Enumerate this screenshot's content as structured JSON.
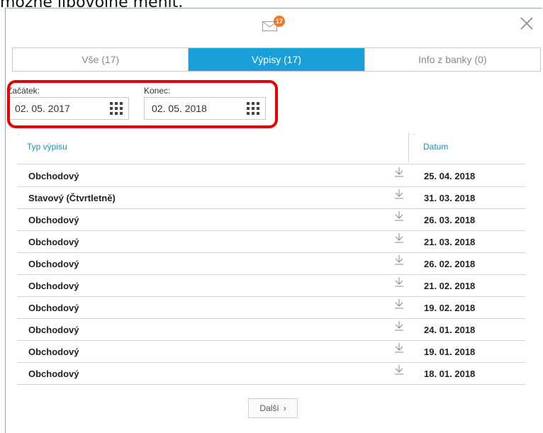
{
  "top_text": "možné libovolně měnit.",
  "header": {
    "unread_count": "17"
  },
  "tabs": [
    {
      "label": "Vše (17)"
    },
    {
      "label": "Výpisy (17)"
    },
    {
      "label": "Info z banky (0)"
    }
  ],
  "filters": {
    "start_label": "Začátek:",
    "start_value": "02. 05. 2017",
    "end_label": "Konec:",
    "end_value": "02. 05. 2018"
  },
  "table": {
    "col_type": "Typ výpisu",
    "col_date": "Datum",
    "rows": [
      {
        "type": "Obchodový",
        "date": "25. 04. 2018"
      },
      {
        "type": "Stavový (Čtvrtletně)",
        "date": "31. 03. 2018"
      },
      {
        "type": "Obchodový",
        "date": "26. 03. 2018"
      },
      {
        "type": "Obchodový",
        "date": "21. 03. 2018"
      },
      {
        "type": "Obchodový",
        "date": "26. 02. 2018"
      },
      {
        "type": "Obchodový",
        "date": "21. 02. 2018"
      },
      {
        "type": "Obchodový",
        "date": "19. 02. 2018"
      },
      {
        "type": "Obchodový",
        "date": "24. 01. 2018"
      },
      {
        "type": "Obchodový",
        "date": "19. 01. 2018"
      },
      {
        "type": "Obchodový",
        "date": "18. 01. 2018"
      }
    ]
  },
  "pagination": {
    "next_label": "Další"
  },
  "colors": {
    "accent": "#1aa0d8",
    "highlight": "#e50000",
    "badge": "#f07a2a"
  }
}
